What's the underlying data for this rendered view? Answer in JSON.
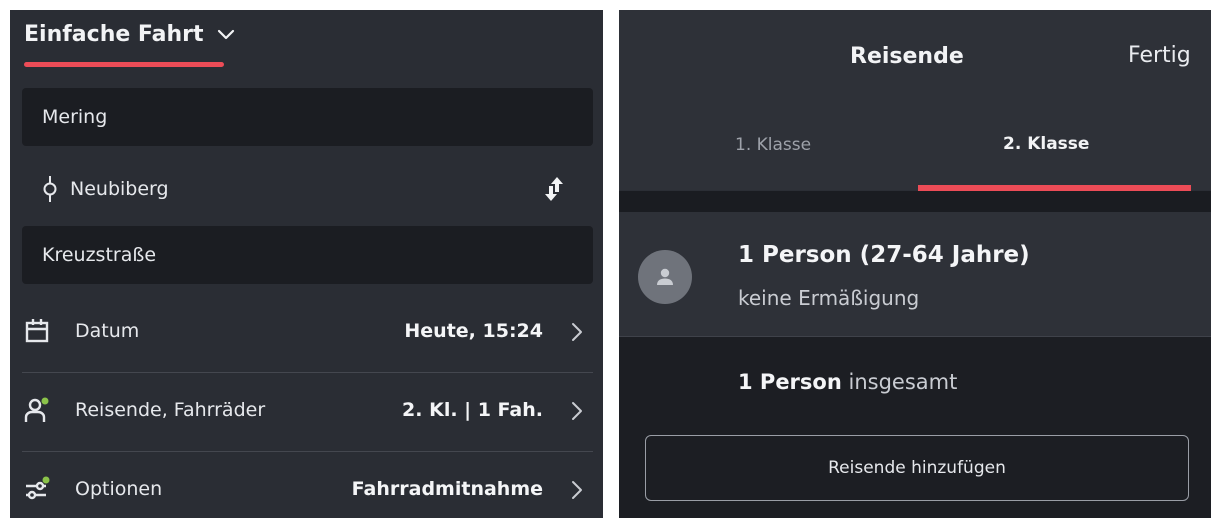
{
  "left": {
    "trip_type": "Einfache Fahrt",
    "from": "Mering",
    "via": "Neubiberg",
    "to": "Kreuzstraße",
    "rows": [
      {
        "label": "Datum",
        "value": "Heute, 15:24",
        "icon": "calendar-icon"
      },
      {
        "label": "Reisende, Fahrräder",
        "value": "2. Kl. | 1 Fah.",
        "icon": "traveller-icon"
      },
      {
        "label": "Optionen",
        "value": "Fahrradmitnahme",
        "icon": "options-icon"
      }
    ],
    "colors": {
      "accent": "#ec4c57",
      "status_dot": "#8bc34a",
      "background": "#2a2d34",
      "field": "#1b1d22"
    }
  },
  "right": {
    "title": "Reisende",
    "done": "Fertig",
    "tabs": [
      {
        "label": "1. Klasse",
        "active": false
      },
      {
        "label": "2. Klasse",
        "active": true
      }
    ],
    "person": {
      "name": "1 Person (27-64 Jahre)",
      "discount": "keine Ermäßigung",
      "icon": "person-avatar-icon"
    },
    "summary": {
      "count": "1 Person",
      "suffix": "insgesamt"
    },
    "add_button": "Reisende hinzufügen"
  }
}
